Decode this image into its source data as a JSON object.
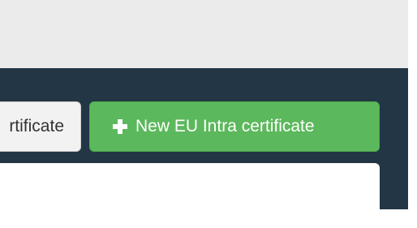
{
  "toolbar": {
    "secondary_button_label": "rtificate",
    "primary_button_label": "New EU Intra certificate",
    "primary_button_icon": "plus-icon"
  },
  "colors": {
    "header_background": "#ebebeb",
    "toolbar_background": "#233645",
    "primary_button": "#5cb85c",
    "secondary_button": "#f2f2f2"
  }
}
